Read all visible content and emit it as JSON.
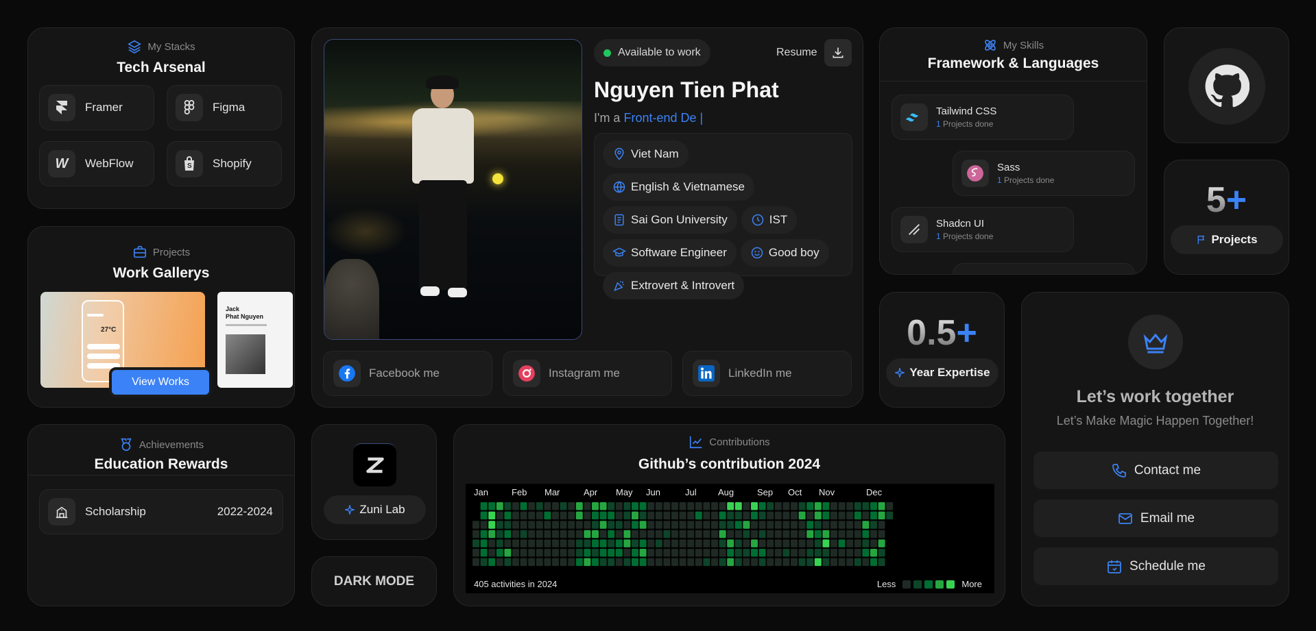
{
  "stacks": {
    "subtitle": "My Stacks",
    "title": "Tech Arsenal",
    "items": [
      {
        "label": "Framer",
        "icon": "framer-icon"
      },
      {
        "label": "Figma",
        "icon": "figma-icon"
      },
      {
        "label": "WebFlow",
        "icon": "webflow-icon"
      },
      {
        "label": "Shopify",
        "icon": "shopify-icon"
      }
    ]
  },
  "projects": {
    "subtitle": "Projects",
    "title": "Work Gallerys",
    "button": "View Works",
    "preview1": {
      "temp": "27°C"
    },
    "preview2": {
      "name_line1": "Jack",
      "name_line2": "Phat Nguyen"
    }
  },
  "achievements": {
    "subtitle": "Achievements",
    "title": "Education Rewards",
    "items": [
      {
        "label": "Scholarship",
        "years": "2022-2024"
      }
    ]
  },
  "profile": {
    "status": "Available to work",
    "resume": "Resume",
    "name": "Nguyen Tien Phat",
    "role_prefix": "I'm a",
    "role_typed": "Front-end De",
    "chips": [
      {
        "label": "Viet Nam",
        "icon": "location-icon"
      },
      {
        "label": "English & Vietnamese",
        "icon": "globe-icon"
      },
      {
        "label": "Sai Gon University",
        "icon": "book-icon"
      },
      {
        "label": "IST",
        "icon": "clock-icon"
      },
      {
        "label": "Software Engineer",
        "icon": "graduation-cap-icon"
      },
      {
        "label": "Good boy",
        "icon": "smile-icon"
      },
      {
        "label": "Extrovert & Introvert",
        "icon": "party-icon"
      }
    ],
    "socials": [
      {
        "label": "Facebook me",
        "icon": "facebook-icon",
        "color": "#1877f2"
      },
      {
        "label": "Instagram me",
        "icon": "instagram-icon",
        "color": "#e4405f"
      },
      {
        "label": "LinkedIn me",
        "icon": "linkedin-icon",
        "color": "#0a66c2"
      }
    ]
  },
  "skills": {
    "subtitle": "My Skills",
    "title": "Framework & Languages",
    "items": [
      {
        "name": "Tailwind CSS",
        "count": "1",
        "suffix": " Projects done"
      },
      {
        "name": "Sass",
        "count": "1",
        "suffix": " Projects done"
      },
      {
        "name": "Shadcn UI",
        "count": "1",
        "suffix": " Projects done"
      }
    ]
  },
  "github": {
    "icon": "github-icon"
  },
  "project_count": {
    "number": "5",
    "plus": "+",
    "label": "Projects"
  },
  "expertise": {
    "number": "0.5",
    "plus": "+",
    "label": "Year Expertise"
  },
  "work_together": {
    "title": "Let’s work together",
    "subtitle": "Let’s Make Magic Happen Together!",
    "actions": [
      {
        "label": "Contact me",
        "icon": "phone-icon"
      },
      {
        "label": "Email me",
        "icon": "mail-icon"
      },
      {
        "label": "Schedule me",
        "icon": "calendar-icon"
      }
    ]
  },
  "zuni": {
    "label": "Zuni Lab"
  },
  "theme": {
    "label": "DARK MODE"
  },
  "contributions": {
    "subtitle": "Contributions",
    "title": "Github’s contribution 2024",
    "months": [
      "Jan",
      "Feb",
      "Mar",
      "Apr",
      "May",
      "Jun",
      "Jul",
      "Aug",
      "Sep",
      "Oct",
      "Nov",
      "Dec"
    ],
    "total": "405 activities in 2024",
    "less": "Less",
    "more": "More",
    "colors": [
      "#1f2a24",
      "#0e4429",
      "#006d32",
      "#26a641",
      "#39d353"
    ]
  }
}
